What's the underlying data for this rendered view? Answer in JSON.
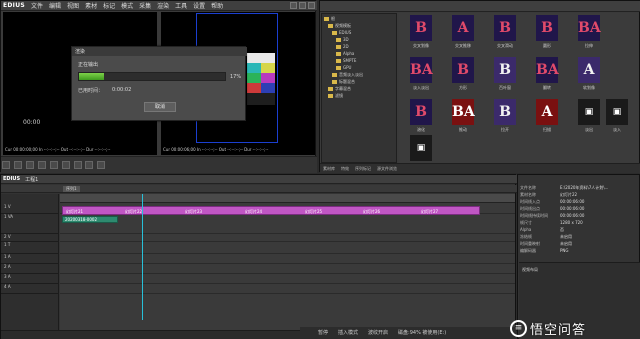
{
  "player": {
    "app_name": "EDIUS",
    "menu": [
      "文件",
      "编辑",
      "视图",
      "素材",
      "标记",
      "模式",
      "采集",
      "渲染",
      "工具",
      "设置",
      "帮助"
    ],
    "timecode_left": "00:00",
    "timecode_player": "Cur 00:00:00;00  In --:--:--;--  Out --:--:--;--  Dur --:--:--;--",
    "timecode_recorder": "Cur 00:00:06;00  In --:--:--;--  Out --:--:--;--  Dur --:--:--;--"
  },
  "dialog": {
    "title": "渲染",
    "status": "正在输出",
    "progress_percent": 17,
    "progress_text": "17%",
    "elapsed_label": "已用时间：",
    "elapsed_value": "0:00:02",
    "cancel_label": "取消"
  },
  "bin": {
    "tree": [
      "根",
      "视频模板",
      "EDIUS",
      "3D",
      "2D",
      "Alpha",
      "SMPTE",
      "GPU",
      "音频淡入淡出",
      "标题混合",
      "字幕混合",
      "滤镜"
    ],
    "clips": [
      {
        "glyph": "B",
        "style": "red-text",
        "caption": "交叉划像"
      },
      {
        "glyph": "A",
        "style": "red-text",
        "caption": "交叉推移"
      },
      {
        "glyph": "B",
        "style": "red-text",
        "caption": "交叉滑动"
      },
      {
        "glyph": "B",
        "style": "red-text",
        "caption": "圆形"
      },
      {
        "glyph": "BA",
        "style": "red-text",
        "caption": "拉伸"
      },
      {
        "glyph": "BA",
        "style": "red-text",
        "caption": "淡入淡出"
      },
      {
        "glyph": "B",
        "style": "red-text",
        "caption": "方形"
      },
      {
        "glyph": "B",
        "style": "alt",
        "caption": "百叶窗"
      },
      {
        "glyph": "BA",
        "style": "red-text",
        "caption": "翻转"
      },
      {
        "glyph": "A",
        "style": "alt",
        "caption": "软划像"
      },
      {
        "glyph": "B",
        "style": "red-text",
        "caption": "溶化"
      },
      {
        "glyph": "BA",
        "style": "red",
        "caption": "推动"
      },
      {
        "glyph": "B",
        "style": "alt",
        "caption": "拉开"
      },
      {
        "glyph": "A",
        "style": "red",
        "caption": "扫描"
      },
      {
        "glyph": "▣",
        "style": "icon",
        "caption": "淡出"
      },
      {
        "glyph": "▣",
        "style": "icon",
        "caption": "淡入"
      },
      {
        "glyph": "▣",
        "style": "icon",
        "caption": "帧叠化"
      }
    ],
    "tabs": [
      "素材库",
      "特效",
      "序列标记",
      "源文件浏览"
    ]
  },
  "timeline": {
    "app_name": "EDIUS",
    "project_name": "工程1",
    "sequence_tab": "序列1",
    "tracks": [
      "1 V",
      "1 VA",
      "2 V",
      "1 T",
      "1 A",
      "2 A",
      "3 A",
      "4 A"
    ],
    "video_clips": [
      "幻灯片21",
      "幻灯片22",
      "幻灯片23",
      "幻灯片24",
      "幻灯片25",
      "幻灯片26",
      "幻灯片27"
    ],
    "audio_clip": "20200318-0002",
    "status": [
      "暂停",
      "插入模式",
      "波纹开启",
      "磁盘:94% 被使用(E:)"
    ]
  },
  "info": {
    "rows": [
      {
        "key": "文件名称",
        "value": "E:\\2020年资料\\7人计划\\..."
      },
      {
        "key": "素材名称",
        "value": "幻灯片22"
      },
      {
        "key": "时间线入点",
        "value": "00:00:06:00"
      },
      {
        "key": "时间线出点",
        "value": "00:00:06:00"
      },
      {
        "key": "时间线持续时间",
        "value": "00:00:06:00"
      },
      {
        "key": "帧尺寸",
        "value": "1280 x 720"
      },
      {
        "key": "Alpha",
        "value": "否"
      },
      {
        "key": "冻结帧",
        "value": "未启用"
      },
      {
        "key": "时间重映射",
        "value": "未启用"
      },
      {
        "key": "编解码器",
        "value": "PNG"
      }
    ],
    "effect": "视频布局"
  },
  "watermark": {
    "text": "悟空问答"
  }
}
